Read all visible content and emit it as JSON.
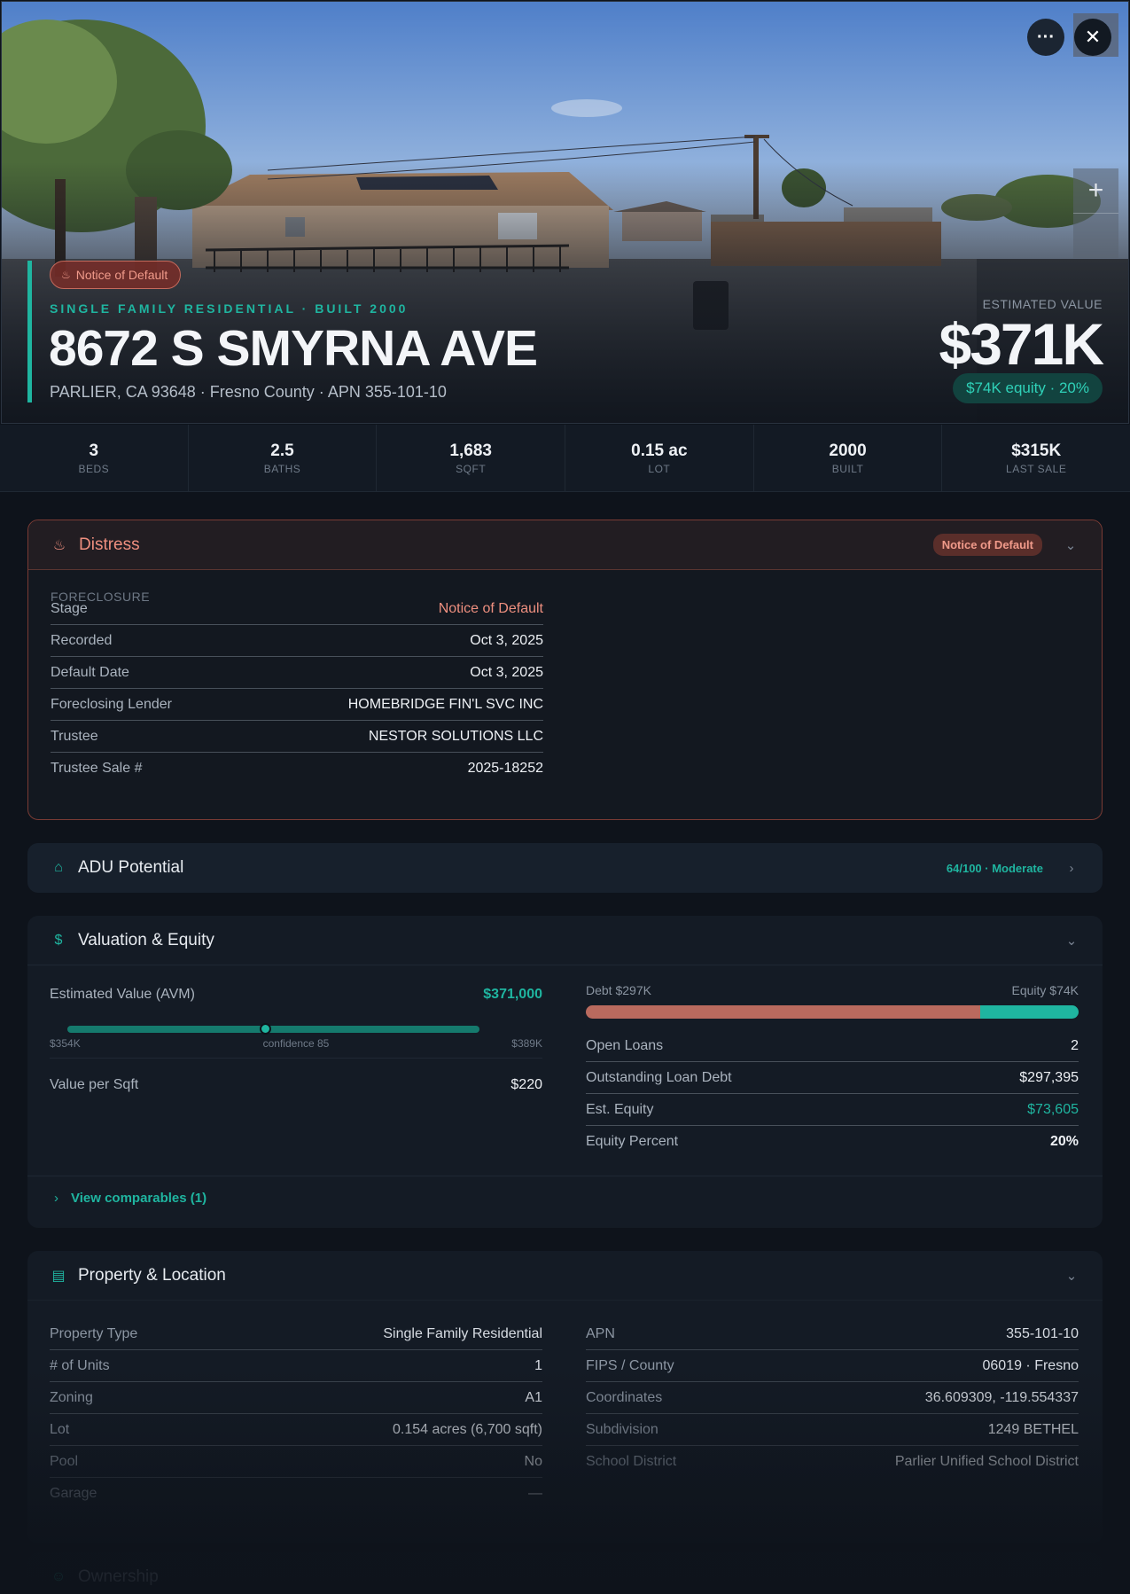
{
  "hero": {
    "badge": "Notice of Default",
    "subtitle": "SINGLE FAMILY RESIDENTIAL · BUILT 2000",
    "title": "8672 S SMYRNA AVE",
    "address": "PARLIER, CA 93648 · Fresno County · APN 355-101-10",
    "estimated_value_label": "ESTIMATED VALUE",
    "estimated_value": "$371K",
    "equity_pill": "$74K equity · 20%",
    "more_icon": "more-horizontal-icon",
    "close_icon": "close-icon",
    "zoom_in": "+"
  },
  "stats": [
    {
      "value": "3",
      "label": "BEDS"
    },
    {
      "value": "2.5",
      "label": "BATHS"
    },
    {
      "value": "1,683",
      "label": "SQFT"
    },
    {
      "value": "0.15 ac",
      "label": "LOT"
    },
    {
      "value": "2000",
      "label": "BUILT"
    },
    {
      "value": "$315K",
      "label": "LAST SALE"
    }
  ],
  "distress": {
    "title": "Distress",
    "badge": "Notice of Default",
    "section": "FORECLOSURE",
    "rows": [
      {
        "k": "Stage",
        "v": "Notice of Default"
      },
      {
        "k": "Recorded",
        "v": "Oct 3, 2025"
      },
      {
        "k": "Default Date",
        "v": "Oct 3, 2025"
      },
      {
        "k": "Foreclosing Lender",
        "v": "HOMEBRIDGE FIN'L SVC INC"
      },
      {
        "k": "Trustee",
        "v": "NESTOR SOLUTIONS LLC"
      },
      {
        "k": "Trustee Sale #",
        "v": "2025-18252"
      }
    ]
  },
  "adu": {
    "title": "ADU Potential",
    "score": "64/100 · Moderate"
  },
  "valuation": {
    "title": "Valuation & Equity",
    "avm_label": "Estimated Value (AVM)",
    "avm_value": "$371,000",
    "range_low": "$354K",
    "range_high": "$389K",
    "confidence": "confidence 85",
    "range_fraction_point": 0.48,
    "value_per_sqft_label": "Value per Sqft",
    "value_per_sqft": "$220",
    "debt_label": "Debt $297K",
    "equity_label": "Equity $74K",
    "debt_fraction": 0.8,
    "rows": [
      {
        "k": "Open Loans",
        "v": "2"
      },
      {
        "k": "Outstanding Loan Debt",
        "v": "$297,395"
      },
      {
        "k": "Est. Equity",
        "v": "$73,605"
      },
      {
        "k": "Equity Percent",
        "v": "20%"
      }
    ],
    "comparables_link": "View comparables (1)"
  },
  "property": {
    "title": "Property & Location",
    "left": [
      {
        "k": "Property Type",
        "v": "Single Family Residential"
      },
      {
        "k": "# of Units",
        "v": "1"
      },
      {
        "k": "Zoning",
        "v": "A1"
      },
      {
        "k": "Lot",
        "v": "0.154 acres (6,700 sqft)"
      },
      {
        "k": "Pool",
        "v": "No"
      },
      {
        "k": "Garage",
        "v": "—"
      }
    ],
    "right": [
      {
        "k": "APN",
        "v": "355-101-10"
      },
      {
        "k": "FIPS / County",
        "v": "06019 · Fresno"
      },
      {
        "k": "Coordinates",
        "v": "36.609309, -119.554337"
      },
      {
        "k": "Subdivision",
        "v": "1249 BETHEL"
      },
      {
        "k": "School District",
        "v": "Parlier Unified School District"
      }
    ]
  },
  "ownership": {
    "title": "Ownership"
  },
  "colors": {
    "accent": "#1fb5a0",
    "distress": "#ee8f7f",
    "debt": "#b96a5e",
    "background": "#0e131b"
  }
}
